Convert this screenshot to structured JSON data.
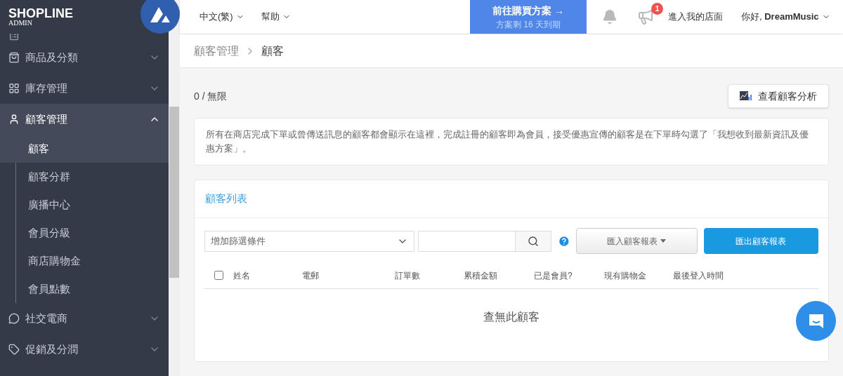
{
  "logo": {
    "name": "SHOPLINE",
    "sub": "ADMIN"
  },
  "sidebar": {
    "items": [
      {
        "label": "商品及分類",
        "kind": "bag",
        "expanded": false,
        "selected": false
      },
      {
        "label": "庫存管理",
        "kind": "boxes",
        "expanded": false,
        "selected": false
      },
      {
        "label": "顧客管理",
        "kind": "person",
        "expanded": true,
        "selected": true,
        "children": [
          {
            "label": "顧客",
            "selected": true
          },
          {
            "label": "顧客分群",
            "selected": false
          },
          {
            "label": "廣播中心",
            "selected": false
          },
          {
            "label": "會員分級",
            "selected": false
          },
          {
            "label": "商店購物金",
            "selected": false
          },
          {
            "label": "會員點數",
            "selected": false
          }
        ]
      },
      {
        "label": "社交電商",
        "kind": "chat",
        "expanded": false,
        "selected": false
      },
      {
        "label": "促銷及分潤",
        "kind": "tag",
        "expanded": false,
        "selected": false
      }
    ]
  },
  "header": {
    "menus": [
      "中文(繁)",
      "幫助"
    ],
    "plan_button": {
      "title": "前往購買方案 →",
      "subtitle": "方案剩 16 天到期"
    },
    "notification_badge": "1",
    "store_link": "進入我的店面",
    "greeting": "你好, ",
    "user": "DreamMusic"
  },
  "breadcrumb": [
    "顧客管理",
    "顧客"
  ],
  "quota": "0 / 無限",
  "analysis_button": "查看顧客分析",
  "notice": "所有在商店完成下單或曾傳送訊息的顧客都會顯示在這裡，完成註冊的顧客即為會員，接受優惠宣傳的顧客是在下單時勾選了「我想收到最新資訊及優惠方案」。",
  "customer_list": {
    "title": "顧客列表",
    "filter_placeholder": "增加篩選條件",
    "import_button": "匯入顧客報表",
    "export_button": "匯出顧客報表",
    "table": {
      "select_all": false,
      "columns": [
        "姓名",
        "電郵",
        "訂單數",
        "累積金額",
        "已是會員?",
        "現有購物金",
        "最後登入時間"
      ]
    },
    "empty": "查無此顧客"
  }
}
